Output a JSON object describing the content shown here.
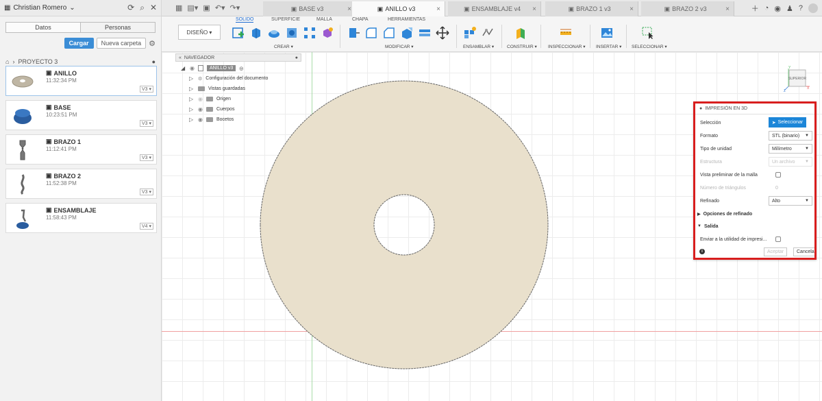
{
  "left_panel": {
    "user": "Christian Romero",
    "tabs": [
      "Datos",
      "Personas"
    ],
    "upload_label": "Cargar",
    "new_folder_label": "Nueva carpeta",
    "breadcrumb": "PROYECTO 3",
    "files": [
      {
        "name": "ANILLO",
        "time": "11:32:34 PM",
        "version": "V3"
      },
      {
        "name": "BASE",
        "time": "10:23:51 PM",
        "version": "V3"
      },
      {
        "name": "BRAZO 1",
        "time": "11:12:41 PM",
        "version": "V3"
      },
      {
        "name": "BRAZO 2",
        "time": "11:52:38 PM",
        "version": "V3"
      },
      {
        "name": "ENSAMBLAJE",
        "time": "11:58:43 PM",
        "version": "V4"
      }
    ]
  },
  "doc_tabs": [
    "BASE v3",
    "ANILLO v3",
    "ENSAMBLAJE v4",
    "BRAZO 1 v3",
    "BRAZO 2 v3"
  ],
  "toolbar": {
    "design_label": "DISEÑO",
    "tabs": [
      "SOLIDO",
      "SUPERFICIE",
      "MALLA",
      "CHAPA",
      "HERRAMIENTAS"
    ],
    "groups": [
      "CREAR",
      "MODIFICAR",
      "ENSAMBLAR",
      "CONSTRUIR",
      "INSPECCIONAR",
      "INSERTAR",
      "SELECCIONAR"
    ]
  },
  "navigator": {
    "title": "NAVEGADOR",
    "root": "ANILLO v3",
    "items": [
      "Configuración del documento",
      "Vistas guardadas",
      "Origen",
      "Cuerpos",
      "Bocetos"
    ]
  },
  "viewcube": {
    "label": "SUPERIOR",
    "axis_x": "X",
    "axis_y": "Y",
    "axis_z": "Z"
  },
  "dialog": {
    "title": "IMPRESIÓN EN 3D",
    "selection_label": "Selección",
    "select_button": "Seleccionar",
    "format_label": "Formato",
    "format_value": "STL (binario)",
    "unit_label": "Tipo de unidad",
    "unit_value": "Milímetro",
    "structure_label": "Estructura",
    "structure_value": "Un archivo",
    "preview_label": "Vista preliminar de la malla",
    "triangles_label": "Número de triángulos",
    "triangles_value": "0",
    "refine_label": "Refinado",
    "refine_value": "Alto",
    "refine_options": "Opciones de refinado",
    "output": "Salida",
    "send_label": "Enviar a la utilidad de impresi...",
    "ok": "Aceptar",
    "cancel": "Cancelar"
  },
  "colors": {
    "part": "#e9e0cc",
    "accent": "#1c86d8",
    "highlight": "#d81e1e"
  }
}
